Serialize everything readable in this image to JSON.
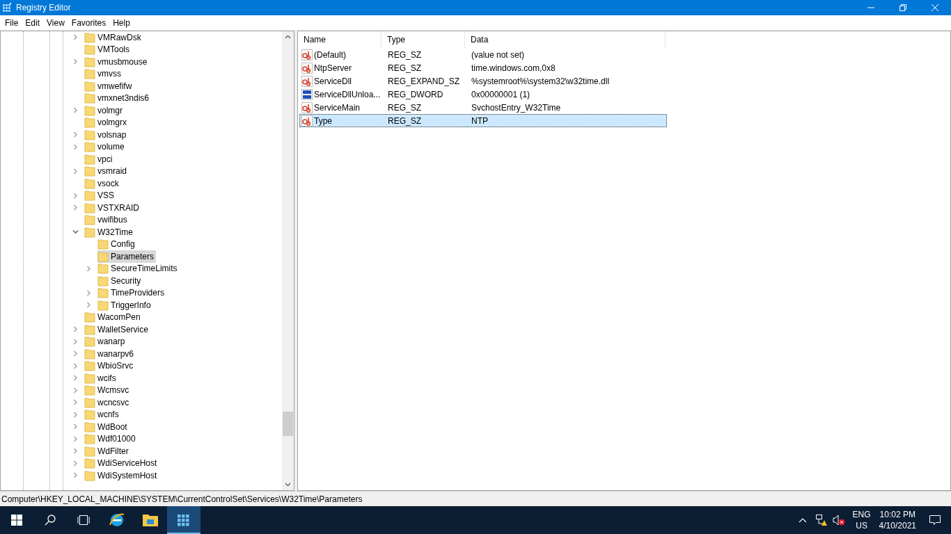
{
  "window": {
    "title": "Registry Editor"
  },
  "menu": [
    "File",
    "Edit",
    "View",
    "Favorites",
    "Help"
  ],
  "tree": [
    {
      "label": "VMRawDsk",
      "expandable": true,
      "selected": false
    },
    {
      "label": "VMTools",
      "expandable": false,
      "selected": false
    },
    {
      "label": "vmusbmouse",
      "expandable": true,
      "selected": false
    },
    {
      "label": "vmvss",
      "expandable": false,
      "selected": false
    },
    {
      "label": "vmwefifw",
      "expandable": false,
      "selected": false
    },
    {
      "label": "vmxnet3ndis6",
      "expandable": false,
      "selected": false
    },
    {
      "label": "volmgr",
      "expandable": true,
      "selected": false
    },
    {
      "label": "volmgrx",
      "expandable": false,
      "selected": false
    },
    {
      "label": "volsnap",
      "expandable": true,
      "selected": false
    },
    {
      "label": "volume",
      "expandable": true,
      "selected": false
    },
    {
      "label": "vpci",
      "expandable": false,
      "selected": false
    },
    {
      "label": "vsmraid",
      "expandable": true,
      "selected": false
    },
    {
      "label": "vsock",
      "expandable": false,
      "selected": false
    },
    {
      "label": "VSS",
      "expandable": true,
      "selected": false
    },
    {
      "label": "VSTXRAID",
      "expandable": true,
      "selected": false
    },
    {
      "label": "vwifibus",
      "expandable": false,
      "selected": false
    },
    {
      "label": "W32Time",
      "expandable": true,
      "expanded": true,
      "selected": false,
      "children": [
        {
          "label": "Config",
          "expandable": false,
          "selected": false
        },
        {
          "label": "Parameters",
          "expandable": false,
          "selected": true
        },
        {
          "label": "SecureTimeLimits",
          "expandable": true,
          "selected": false
        },
        {
          "label": "Security",
          "expandable": false,
          "selected": false
        },
        {
          "label": "TimeProviders",
          "expandable": true,
          "selected": false
        },
        {
          "label": "TriggerInfo",
          "expandable": true,
          "selected": false
        }
      ]
    },
    {
      "label": "WacomPen",
      "expandable": false,
      "selected": false
    },
    {
      "label": "WalletService",
      "expandable": true,
      "selected": false
    },
    {
      "label": "wanarp",
      "expandable": true,
      "selected": false
    },
    {
      "label": "wanarpv6",
      "expandable": true,
      "selected": false
    },
    {
      "label": "WbioSrvc",
      "expandable": true,
      "selected": false
    },
    {
      "label": "wcifs",
      "expandable": true,
      "selected": false
    },
    {
      "label": "Wcmsvc",
      "expandable": true,
      "selected": false
    },
    {
      "label": "wcncsvc",
      "expandable": true,
      "selected": false
    },
    {
      "label": "wcnfs",
      "expandable": true,
      "selected": false
    },
    {
      "label": "WdBoot",
      "expandable": true,
      "selected": false
    },
    {
      "label": "Wdf01000",
      "expandable": true,
      "selected": false
    },
    {
      "label": "WdFilter",
      "expandable": true,
      "selected": false
    },
    {
      "label": "WdiServiceHost",
      "expandable": true,
      "selected": false
    },
    {
      "label": "WdiSystemHost",
      "expandable": true,
      "selected": false
    }
  ],
  "table": {
    "columns": [
      "Name",
      "Type",
      "Data"
    ],
    "rows": [
      {
        "kind": "string",
        "name": "(Default)",
        "type": "REG_SZ",
        "data": "(value not set)",
        "selected": false
      },
      {
        "kind": "string",
        "name": "NtpServer",
        "type": "REG_SZ",
        "data": "time.windows.com,0x8",
        "selected": false
      },
      {
        "kind": "string",
        "name": "ServiceDll",
        "type": "REG_EXPAND_SZ",
        "data": "%systemroot%\\system32\\w32time.dll",
        "selected": false
      },
      {
        "kind": "binary",
        "name": "ServiceDllUnloa...",
        "type": "REG_DWORD",
        "data": "0x00000001 (1)",
        "selected": false
      },
      {
        "kind": "string",
        "name": "ServiceMain",
        "type": "REG_SZ",
        "data": "SvchostEntry_W32Time",
        "selected": false
      },
      {
        "kind": "string",
        "name": "Type",
        "type": "REG_SZ",
        "data": "NTP",
        "selected": true
      }
    ]
  },
  "status_bar": "Computer\\HKEY_LOCAL_MACHINE\\SYSTEM\\CurrentControlSet\\Services\\W32Time\\Parameters",
  "taskbar": {
    "language": "ENG",
    "region": "US",
    "time": "10:02 PM",
    "date": "4/10/2021"
  }
}
